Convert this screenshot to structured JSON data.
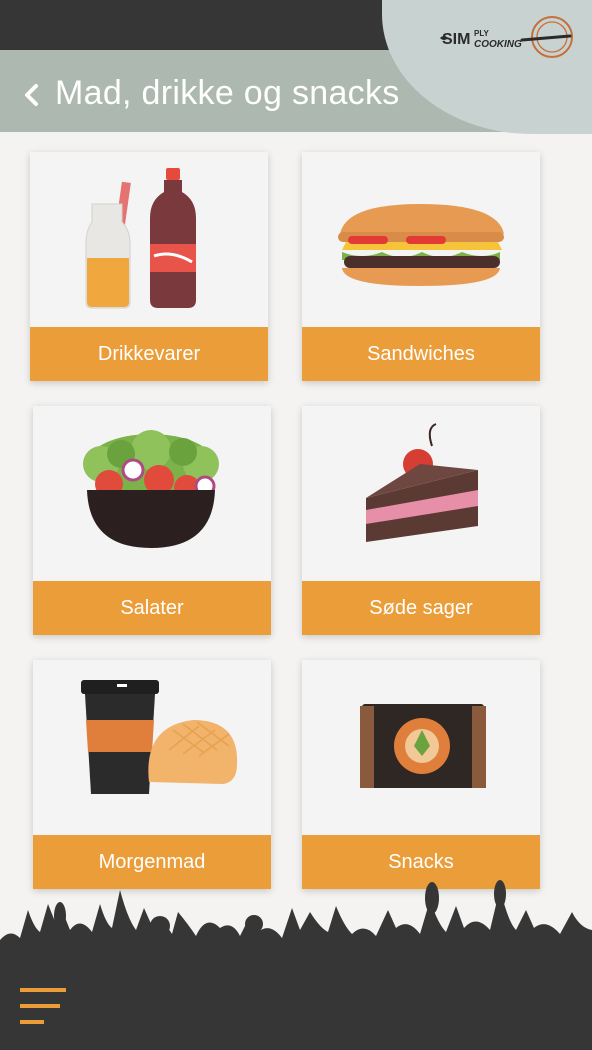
{
  "header": {
    "title": "Mad, drikke og snacks",
    "logo_text": "SIMPLY COOKING"
  },
  "categories": [
    {
      "label": "Drikkevarer",
      "icon": "drinks-icon"
    },
    {
      "label": "Sandwiches",
      "icon": "sandwich-icon"
    },
    {
      "label": "Salater",
      "icon": "salad-icon"
    },
    {
      "label": "Søde sager",
      "icon": "cake-icon"
    },
    {
      "label": "Morgenmad",
      "icon": "breakfast-icon"
    },
    {
      "label": "Snacks",
      "icon": "snack-bar-icon"
    }
  ],
  "colors": {
    "accent": "#ea9d39",
    "header_dark": "#363636",
    "title_bar": "#adb8b0",
    "background": "#f4f3f1"
  }
}
